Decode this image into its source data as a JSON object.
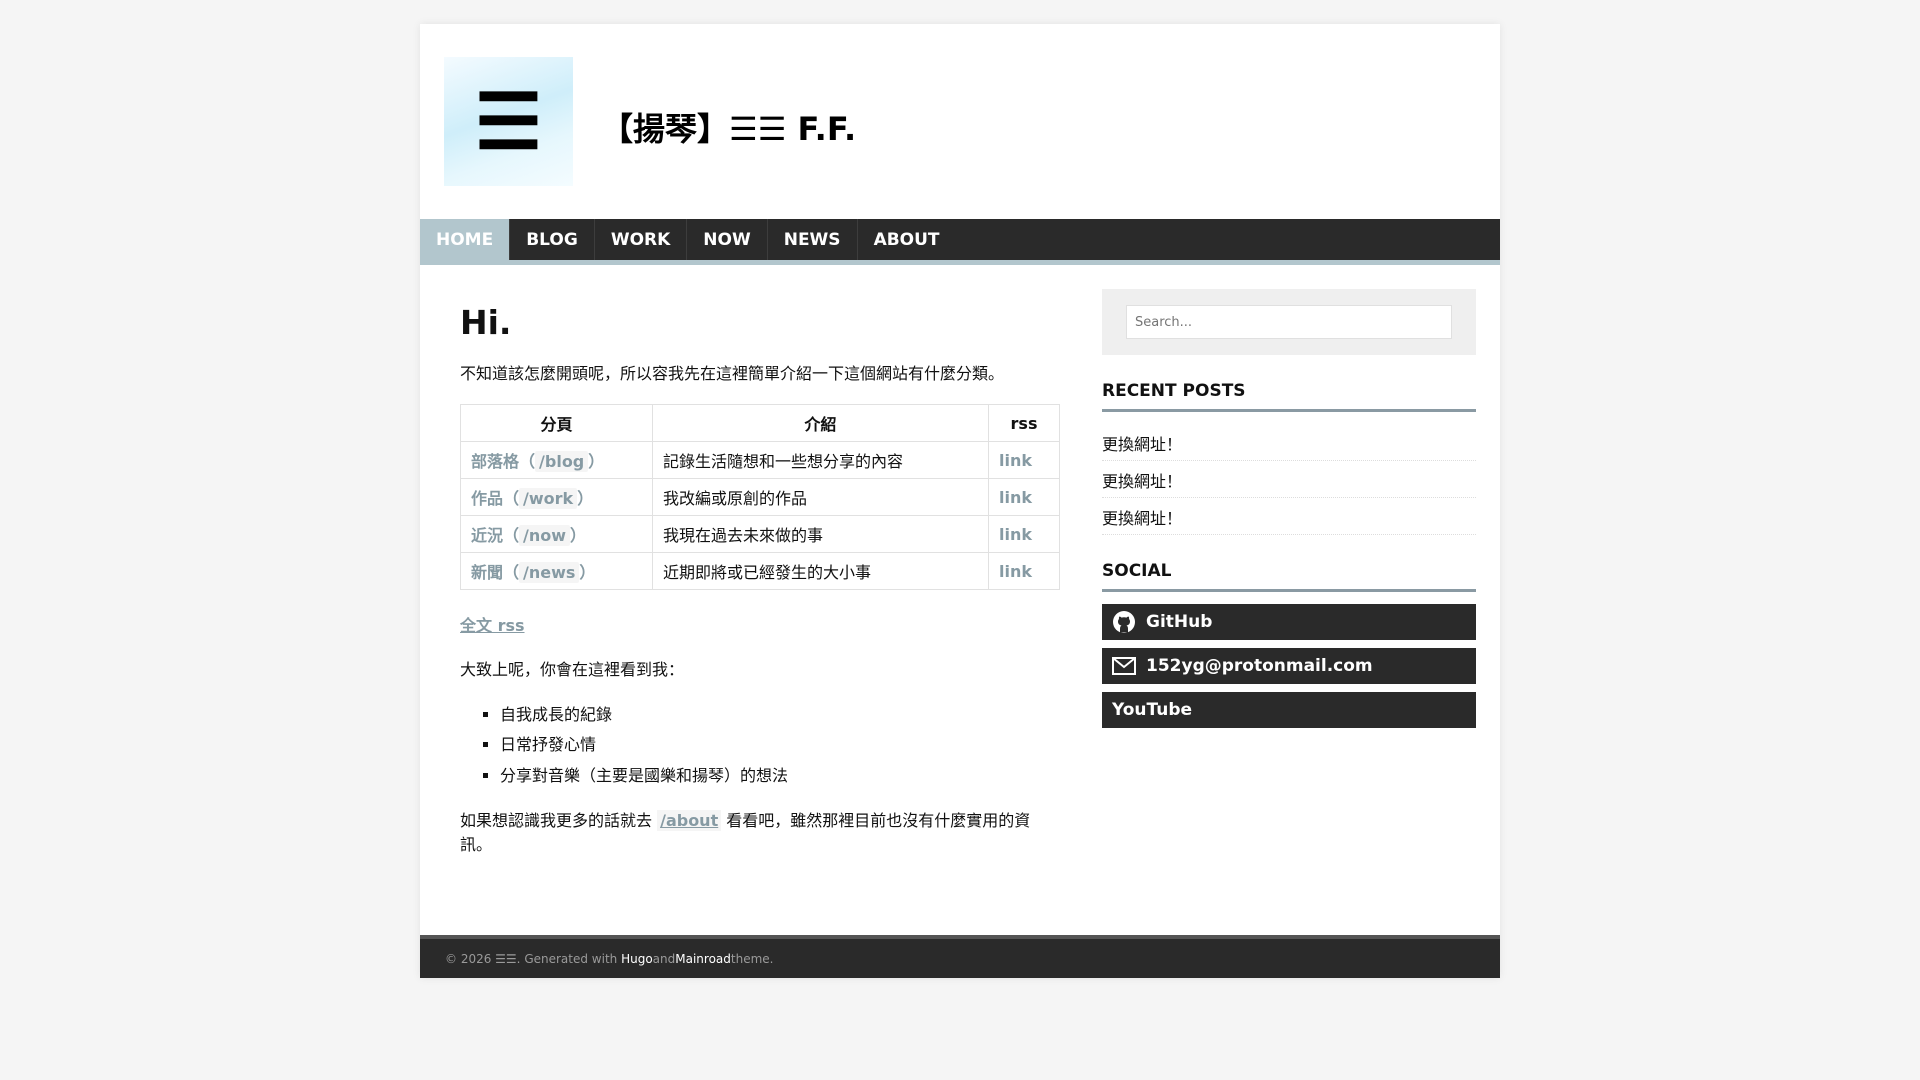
{
  "site": {
    "logo_glyph": "☰",
    "title": "【揚琴】☰☰ F.F."
  },
  "nav": [
    {
      "label": "HOME",
      "active": true
    },
    {
      "label": "BLOG",
      "active": false
    },
    {
      "label": "WORK",
      "active": false
    },
    {
      "label": "NOW",
      "active": false
    },
    {
      "label": "NEWS",
      "active": false
    },
    {
      "label": "ABOUT",
      "active": false
    }
  ],
  "main": {
    "heading": "Hi.",
    "intro": "不知道該怎麼開頭呢，所以容我先在這裡簡單介紹一下這個網站有什麼分類。",
    "table": {
      "headers": [
        "分頁",
        "介紹",
        "rss"
      ],
      "rows": [
        {
          "name": "部落格",
          "path": "/blog",
          "desc": "記錄生活隨想和一些想分享的內容",
          "rss": "link"
        },
        {
          "name": "作品",
          "path": "/work",
          "desc": "我改編或原創的作品",
          "rss": "link"
        },
        {
          "name": "近況",
          "path": "/now",
          "desc": "我現在過去未來做的事",
          "rss": "link"
        },
        {
          "name": "新聞",
          "path": "/news",
          "desc": "近期即將或已經發生的大小事",
          "rss": "link"
        }
      ]
    },
    "full_rss": "全文 rss",
    "lead": "大致上呢，你會在這裡看到我：",
    "bullets": [
      "自我成長的紀錄",
      "日常抒發心情",
      "分享對音樂（主要是國樂和揚琴）的想法"
    ],
    "outro_before": "如果想認識我更多的話就去 ",
    "outro_link": "/about",
    "outro_after": " 看看吧，雖然那裡目前也沒有什麼實用的資訊。"
  },
  "sidebar": {
    "search_placeholder": "Search...",
    "recent_title": "RECENT POSTS",
    "recent_posts": [
      "更換網址！",
      "更換網址！",
      "更換網址！"
    ],
    "social_title": "SOCIAL",
    "social": [
      {
        "label": "GitHub",
        "icon": "github-icon"
      },
      {
        "label": "152yg@protonmail.com",
        "icon": "mail-icon"
      },
      {
        "label": "YouTube",
        "icon": ""
      }
    ]
  },
  "footer": {
    "copyright": "© 2026 ☰☰. Generated with ",
    "hugo": "Hugo",
    "and": " and ",
    "mainroad": "Mainroad",
    "theme": " theme."
  },
  "colors": {
    "accent": "#b2c6cd",
    "nav_bg": "#2a2a2a",
    "link": "#869aa3"
  }
}
